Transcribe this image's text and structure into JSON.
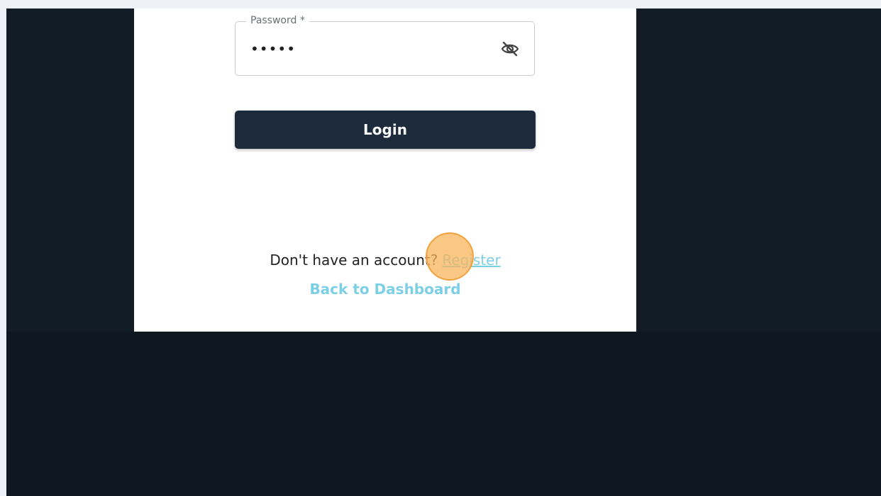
{
  "login_form": {
    "password": {
      "label": "Password *",
      "value": "•••••",
      "toggle_icon": "eye-off-icon"
    },
    "login_button_label": "Login",
    "register_prompt": "Don't have an account?",
    "register_link": "Register",
    "back_link": "Back to Dashboard"
  },
  "colors": {
    "page_background": "#121c27",
    "button_background": "#1d2b3c",
    "link_color": "#7dcfe6",
    "click_marker": "#f8b45c"
  }
}
